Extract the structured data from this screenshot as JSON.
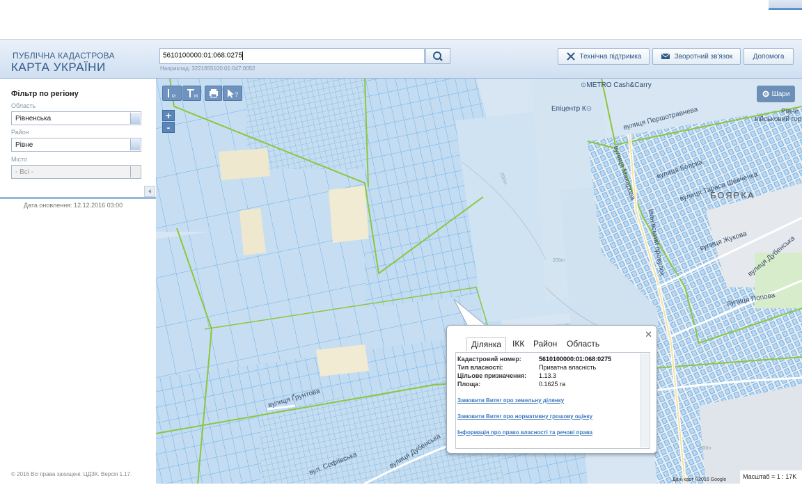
{
  "header": {
    "brand_line1": "ПУБЛІЧНА КАДАСТРОВА",
    "brand_line2": "КАРТА УКРАЇНИ",
    "search_value": "5610100000:01:068:0275",
    "search_hint": "Наприклад: 3221655100:01:047:0052",
    "tech_support_label": "Технічна підтримка",
    "feedback_label": "Зворотний зв'язок",
    "help_label": "Допомога"
  },
  "sidebar": {
    "filter_title": "Фільтр по регіону",
    "oblast_label": "Область",
    "oblast_value": "Рівненська",
    "rayon_label": "Район",
    "rayon_value": "Рівне",
    "city_label": "Місто",
    "city_value": "- Всі -",
    "update_date": "Дата оновлення: 12.12.2016 03:00",
    "copyright": "© 2016 Всі права захищені. ЦДЗК. Версія 1.17."
  },
  "map": {
    "layers_label": "Шари",
    "zoom_in": "+",
    "zoom_out": "-",
    "labels": {
      "metro": "METRO Cash&Carry",
      "epicentr": "Епіцентр К",
      "rivne_line1": "Рівне",
      "rivne_line2": "військовий гор",
      "boyarka": "БОЯРКА",
      "street_pershotravneva": "вулиця Першотравнева",
      "street_makarova": "вулиця Макарова",
      "street_boyarka": "вулиця Боярка",
      "street_taras": "вулиця Тараса Шевченка",
      "street_popova": "вулиця Попова",
      "street_zhukova": "вулиця Жукова",
      "street_dubenska": "вулиця Дубенська",
      "street_gruntova": "вулиця Ґрунтова",
      "street_sofiivska": "вул. Софіївська",
      "street_dubenska_lower": "вулиця Дубенська",
      "lane_ivanovskyi": "Іванівський провулок",
      "height_200m": "200m",
      "height_200m_b": "200m",
      "height_200m_c": "200m"
    },
    "attribution": "Дані карт ©2016 Google",
    "scale": "Масштаб = 1 : 17K"
  },
  "popup": {
    "tabs": [
      "Ділянка",
      "ІКК",
      "Район",
      "Область"
    ],
    "fields": [
      {
        "key": "Кадастровий номер:",
        "value": "5610100000:01:068:0275"
      },
      {
        "key": "Тип власності:",
        "value": "Приватна власність"
      },
      {
        "key": "Цільове призначення:",
        "value": "1.13.3"
      },
      {
        "key": "Площа:",
        "value": "0.1625 га"
      }
    ],
    "links": [
      "Замовити Витяг про земельну ділянку",
      "Замовити Витяг про нормативну грошову оцінку",
      "Інформація про право власності та речові права"
    ]
  },
  "colors": {
    "parcel_fill": "#bcd8f0",
    "parcel_stroke": "#5aa7e6",
    "boundary_green": "#8bc63f",
    "header_text": "#2f5888"
  }
}
